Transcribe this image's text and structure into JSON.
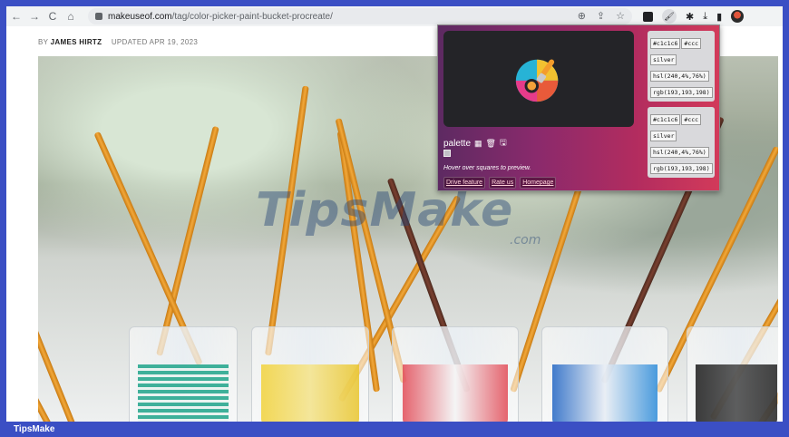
{
  "browser": {
    "url_host": "makeuseof.com",
    "url_path": "/tag/color-picker-paint-bucket-procreate/",
    "nav": {
      "back": "←",
      "forward": "→",
      "reload": "C",
      "home": "⌂"
    },
    "omni_icons": [
      "⊕",
      "⇪",
      "☆"
    ],
    "ext_icons": [
      "extension-square-icon",
      "color-picker-icon",
      "puzzle-icon",
      "download-icon",
      "sidepanel-icon",
      "profile-avatar"
    ]
  },
  "article": {
    "by_prefix": "BY",
    "author": "JAMES HIRTZ",
    "updated": "UPDATED APR 19, 2023",
    "watermark": "TipsMake",
    "watermark_suffix": ".com"
  },
  "popup": {
    "color_cards": [
      {
        "hex": "#c1c1c6",
        "short_hex": "#ccc",
        "name": "silver",
        "hsl": "hsl(240,4%,76%)",
        "rgb": "rgb(193,193,198)"
      },
      {
        "hex": "#c1c1c6",
        "short_hex": "#ccc",
        "name": "silver",
        "hsl": "hsl(240,4%,76%)",
        "rgb": "rgb(193,193,198)"
      }
    ],
    "palette_label": "palette",
    "palette_icons": [
      "grid-icon",
      "trash-icon",
      "save-icon"
    ],
    "hint": "Hover over squares to preview.",
    "links": [
      "Drive feature",
      "Rate us",
      "Homepage"
    ],
    "swatch_color": "#c1c1c6"
  },
  "statusbar": {
    "label": "TipsMake"
  },
  "colors": {
    "frame": "#3b4fc4",
    "popup_start": "#5d2a62",
    "popup_end": "#d23a5a"
  }
}
